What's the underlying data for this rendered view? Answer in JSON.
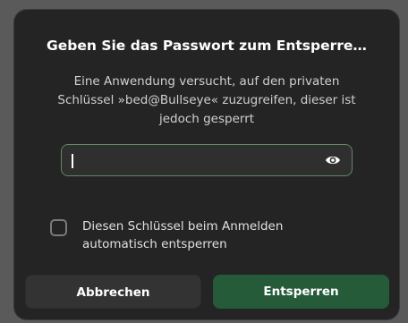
{
  "dialog": {
    "title": "Geben Sie das Passwort zum Entsperre…",
    "message": "Eine Anwendung versucht, auf den privaten Schlüssel »bed@Bullseye« zuzugreifen, dieser ist jedoch gesperrt",
    "password_field": {
      "value": "",
      "reveal_icon": "eye-icon"
    },
    "auto_unlock_checkbox": {
      "label": "Diesen Schlüssel beim Anmelden automatisch entsperren",
      "checked": false
    },
    "buttons": {
      "cancel_label": "Abbrechen",
      "unlock_label": "Entsperren"
    }
  },
  "colors": {
    "dialog_bg": "#242424",
    "entry_border_focus": "#5f8a62",
    "unlock_button_bg": "#265b3a",
    "cancel_button_bg": "#333333"
  }
}
